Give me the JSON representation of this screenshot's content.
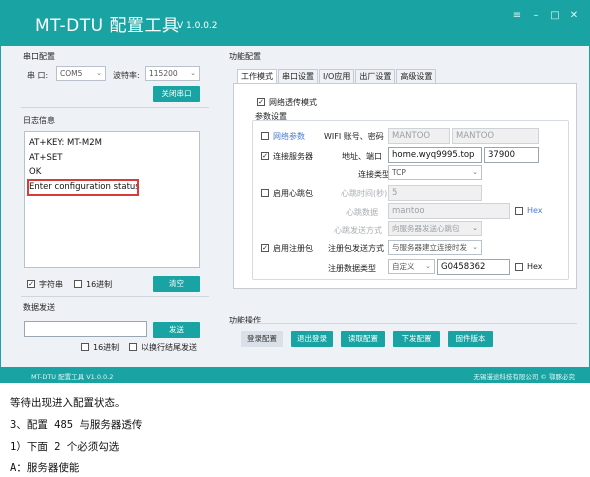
{
  "window": {
    "title": "MT-DTU 配置工具",
    "version": "V 1.0.0.2",
    "controls": [
      "≡",
      "–",
      "□",
      "✕"
    ]
  },
  "serial": {
    "group_label": "串口配置",
    "port_label": "串 口:",
    "port_value": "COM5",
    "baud_label": "波特率:",
    "baud_value": "115200",
    "close_button": "关闭串口"
  },
  "log": {
    "group_label": "日志信息",
    "lines": [
      "AT+KEY: MT-M2M",
      "AT+SET",
      "OK",
      "Enter configuration status"
    ],
    "char_label": "字符串",
    "char_checked": true,
    "hex_label": "16进制",
    "hex_checked": false,
    "clear_button": "清空"
  },
  "send": {
    "group_label": "数据发送",
    "input_value": "",
    "send_button": "发送",
    "hex_label": "16进制",
    "newline_label": "以换行结尾发送"
  },
  "config": {
    "group_label": "功能配置",
    "tabs": [
      "工作模式",
      "串口设置",
      "I/O应用",
      "出厂设置",
      "高级设置"
    ],
    "active_tab": 0,
    "transparent_label": "网络透传模式",
    "transparent_checked": true,
    "params_label": "参数设置",
    "net_params": {
      "label": "网络参数",
      "checked": false,
      "wifi_label": "WIFI 账号、密码",
      "account": "MANTOO",
      "password": "MANTOO"
    },
    "connect_server": {
      "label": "连接服务器",
      "checked": true,
      "addr_label": "地址、端口",
      "address": "home.wyq9995.top",
      "port": "37900",
      "type_label": "连接类型",
      "type_value": "TCP"
    },
    "heartbeat": {
      "label": "启用心跳包",
      "checked": false,
      "time_label": "心跳时间(秒)",
      "time_value": "5",
      "data_label": "心跳数据",
      "data_value": "mantoo",
      "hex_label": "Hex",
      "mode_label": "心跳发送方式",
      "mode_value": "向服务器发送心跳包"
    },
    "register": {
      "label": "启用注册包",
      "checked": true,
      "mode_label": "注册包发送方式",
      "mode_value": "与服务器建立连接时发",
      "type_label": "注册数据类型",
      "type_value": "自定义",
      "data_value": "G0458362",
      "hex_label": "Hex"
    }
  },
  "operations": {
    "group_label": "功能操作",
    "buttons": [
      "登录配置",
      "退出登录",
      "读取配置",
      "下发配置",
      "固件版本"
    ]
  },
  "footer": {
    "left": "MT-DTU 配置工具 V1.0.0.2",
    "right": "无锡漫途科技有限公司 © 鄂豚必究"
  },
  "captions": [
    "等待出现进入配置状态。",
    "3、配置 485 与服务器透传",
    "1）下面 2 个必须勾选",
    "A：服务器使能"
  ]
}
